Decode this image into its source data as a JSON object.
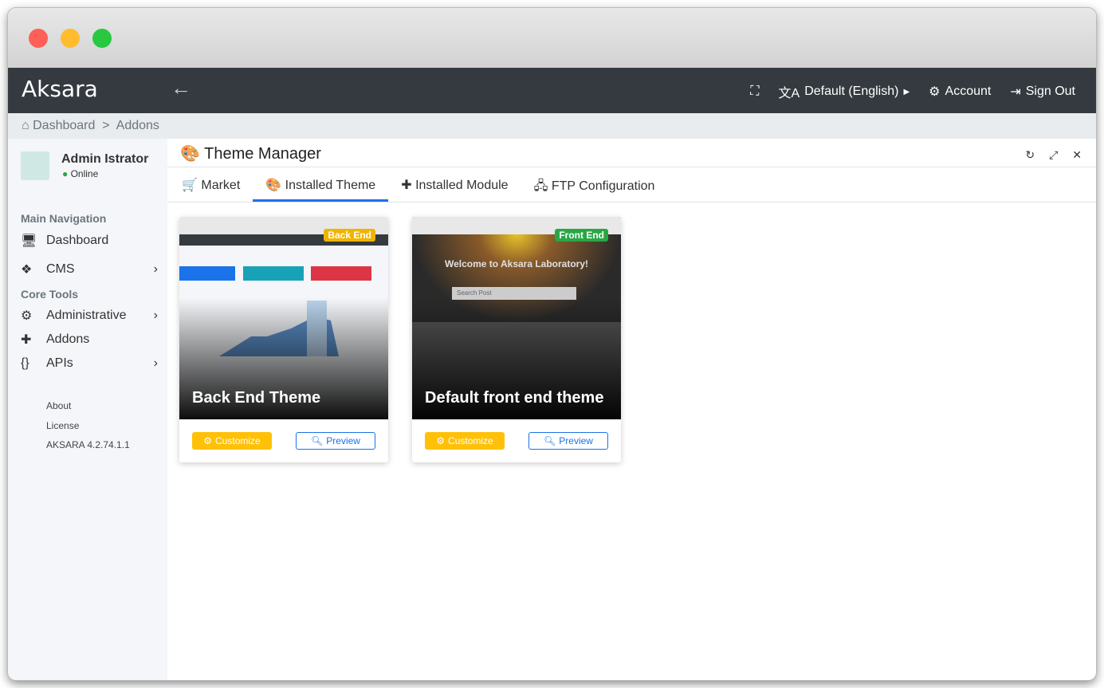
{
  "app": {
    "brand": "Aksara"
  },
  "navbar": {
    "language": "Default (English)",
    "account": "Account",
    "sign_out": "Sign Out"
  },
  "breadcrumb": [
    "Dashboard",
    "Addons"
  ],
  "user": {
    "name": "Admin Istrator",
    "status": "Online"
  },
  "sidebar": {
    "main_nav": "Main Navigation",
    "core_tools": "Core Tools",
    "items": [
      {
        "label": "Dashboard"
      },
      {
        "label": "CMS"
      },
      {
        "label": "Administrative"
      },
      {
        "label": "Addons"
      },
      {
        "label": "APIs"
      }
    ],
    "footer": [
      "About",
      "License",
      "AKSARA 4.2.74.1.1"
    ]
  },
  "page": {
    "title": "Theme Manager",
    "tabs": [
      {
        "label": "Market"
      },
      {
        "label": "Installed Theme"
      },
      {
        "label": "Installed Module"
      },
      {
        "label": "FTP Configuration"
      }
    ]
  },
  "themes": [
    {
      "title": "Back End Theme",
      "badge": "Back End",
      "badge_color": "#f0b400",
      "customize": "Customize",
      "preview": "Preview"
    },
    {
      "title": "Default front end theme",
      "badge": "Front End",
      "badge_color": "#28a745",
      "customize": "Customize",
      "preview": "Preview",
      "preview_heading": "Welcome to Aksara Laboratory!",
      "preview_search": "Search Post"
    }
  ]
}
